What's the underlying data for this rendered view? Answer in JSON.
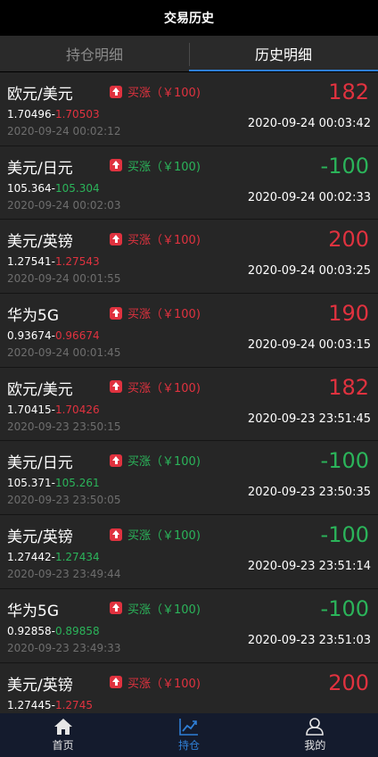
{
  "header": {
    "title": "交易历史"
  },
  "tabs": [
    {
      "label": "持仓明细",
      "active": false
    },
    {
      "label": "历史明细",
      "active": true
    }
  ],
  "colors": {
    "up": "#e0323f",
    "down": "#2bb45a",
    "accent": "#2f7fd6"
  },
  "trades": [
    {
      "pair": "欧元/美元",
      "direction": "买涨（￥100)",
      "open_price": "1.70496",
      "close_price": "1.70503",
      "pnl": "182",
      "trend": "red",
      "open_time": "2020-09-24 00:02:12",
      "close_time": "2020-09-24 00:03:42"
    },
    {
      "pair": "美元/日元",
      "direction": "买涨（￥100)",
      "open_price": "105.364",
      "close_price": "105.304",
      "pnl": "-100",
      "trend": "green",
      "open_time": "2020-09-24 00:02:03",
      "close_time": "2020-09-24 00:02:33"
    },
    {
      "pair": "美元/英镑",
      "direction": "买涨（￥100)",
      "open_price": "1.27541",
      "close_price": "1.27543",
      "pnl": "200",
      "trend": "red",
      "open_time": "2020-09-24 00:01:55",
      "close_time": "2020-09-24 00:03:25"
    },
    {
      "pair": "华为5G",
      "direction": "买涨（￥100)",
      "open_price": "0.93674",
      "close_price": "0.96674",
      "pnl": "190",
      "trend": "red",
      "open_time": "2020-09-24 00:01:45",
      "close_time": "2020-09-24 00:03:15"
    },
    {
      "pair": "欧元/美元",
      "direction": "买涨（￥100)",
      "open_price": "1.70415",
      "close_price": "1.70426",
      "pnl": "182",
      "trend": "red",
      "open_time": "2020-09-23 23:50:15",
      "close_time": "2020-09-23 23:51:45"
    },
    {
      "pair": "美元/日元",
      "direction": "买涨（￥100)",
      "open_price": "105.371",
      "close_price": "105.261",
      "pnl": "-100",
      "trend": "green",
      "open_time": "2020-09-23 23:50:05",
      "close_time": "2020-09-23 23:50:35"
    },
    {
      "pair": "美元/英镑",
      "direction": "买涨（￥100)",
      "open_price": "1.27442",
      "close_price": "1.27434",
      "pnl": "-100",
      "trend": "green",
      "open_time": "2020-09-23 23:49:44",
      "close_time": "2020-09-23 23:51:14"
    },
    {
      "pair": "华为5G",
      "direction": "买涨（￥100)",
      "open_price": "0.92858",
      "close_price": "0.89858",
      "pnl": "-100",
      "trend": "green",
      "open_time": "2020-09-23 23:49:33",
      "close_time": "2020-09-23 23:51:03"
    },
    {
      "pair": "美元/英镑",
      "direction": "买涨（￥100)",
      "open_price": "1.27445",
      "close_price": "1.2745",
      "pnl": "200",
      "trend": "red",
      "open_time": "",
      "close_time": ""
    }
  ],
  "bottom_nav": [
    {
      "label": "首页",
      "icon": "home-icon",
      "active": false
    },
    {
      "label": "持仓",
      "icon": "chart-icon",
      "active": true
    },
    {
      "label": "我的",
      "icon": "user-icon",
      "active": false
    }
  ]
}
